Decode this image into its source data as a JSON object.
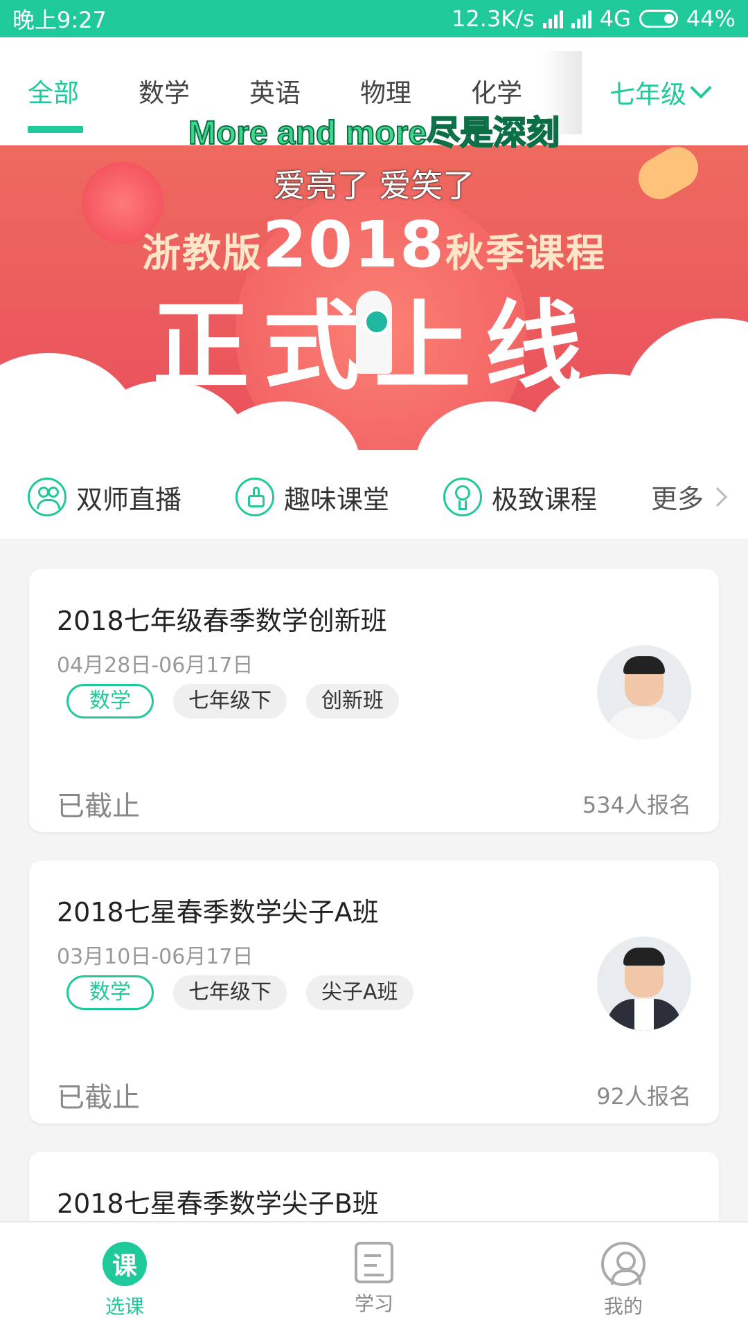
{
  "status_bar": {
    "time": "晚上9:27",
    "speed": "12.3K/s",
    "network": "4G",
    "battery": "44%"
  },
  "subject_tabs": [
    {
      "label": "全部"
    },
    {
      "label": "数学"
    },
    {
      "label": "英语"
    },
    {
      "label": "物理"
    },
    {
      "label": "化学"
    }
  ],
  "grade_selector": {
    "label": "七年级"
  },
  "captions": {
    "line1": "More and more尽是深刻",
    "line2": "爱亮了 爱笑了"
  },
  "banner": {
    "edition": "浙教版",
    "year": "2018",
    "season": "秋季课程",
    "headline": "正式上线"
  },
  "categories": [
    {
      "label": "双师直播",
      "icon": "people-icon"
    },
    {
      "label": "趣味课堂",
      "icon": "thumbs-up-icon"
    },
    {
      "label": "极致课程",
      "icon": "medal-icon"
    },
    {
      "label": "更多",
      "icon": "chevron-right-icon"
    }
  ],
  "courses": [
    {
      "title": "2018七年级春季数学创新班",
      "date": "04月28日-06月17日",
      "tags": [
        "数学",
        "七年级下",
        "创新班"
      ],
      "status": "已截止",
      "enrolled": "534人报名"
    },
    {
      "title": "2018七星春季数学尖子A班",
      "date": "03月10日-06月17日",
      "tags": [
        "数学",
        "七年级下",
        "尖子A班"
      ],
      "status": "已截止",
      "enrolled": "92人报名"
    },
    {
      "title": "2018七星春季数学尖子B班"
    }
  ],
  "bottom_nav": [
    {
      "label": "选课",
      "icon_text": "课"
    },
    {
      "label": "学习"
    },
    {
      "label": "我的"
    }
  ],
  "colors": {
    "accent": "#20c99a",
    "banner": "#ee6a5e"
  }
}
